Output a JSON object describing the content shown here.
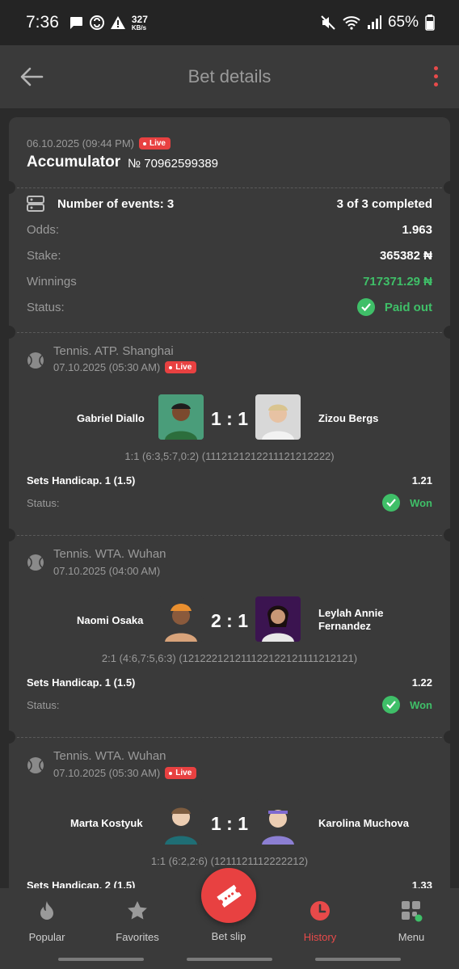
{
  "status_bar": {
    "time": "7:36",
    "speed_value": "327",
    "speed_unit": "KB/s",
    "battery": "65%"
  },
  "app_bar": {
    "title": "Bet details",
    "back_icon": "arrow-left-icon",
    "menu_icon": "kebab-menu-icon"
  },
  "bet": {
    "datetime": "06.10.2025 (09:44 PM)",
    "live_label": "Live",
    "type": "Accumulator",
    "number": "№ 70962599389",
    "events_label": "Number of events: 3",
    "completed": "3 of 3 completed",
    "odds_label": "Odds:",
    "odds_value": "1.963",
    "stake_label": "Stake:",
    "stake_value": "365382 ₦",
    "winnings_label": "Winnings",
    "winnings_value": "717371.29 ₦",
    "status_label": "Status:",
    "status_value": "Paid out"
  },
  "events": [
    {
      "league": "Tennis. ATP. Shanghai",
      "datetime": "07.10.2025 (05:30 AM)",
      "live": "Live",
      "player1": "Gabriel Diallo",
      "player2": "Zizou Bergs",
      "score": "1 : 1",
      "score_detail": "1:1 (6:3,5:7,0:2) (1112121212211121212222)",
      "market": "Sets Handicap. 1 (1.5)",
      "odds": "1.21",
      "status_label": "Status:",
      "status_value": "Won"
    },
    {
      "league": "Tennis. WTA. Wuhan",
      "datetime": "07.10.2025 (04:00 AM)",
      "player1": "Naomi Osaka",
      "player2": "Leylah Annie Fernandez",
      "score": "2 : 1",
      "score_detail": "2:1 (4:6,7:5,6:3) (121222121211122122121111212121)",
      "market": "Sets Handicap. 1 (1.5)",
      "odds": "1.22",
      "status_label": "Status:",
      "status_value": "Won"
    },
    {
      "league": "Tennis. WTA. Wuhan",
      "datetime": "07.10.2025 (05:30 AM)",
      "live": "Live",
      "player1": "Marta Kostyuk",
      "player2": "Karolina Muchova",
      "score": "1 : 1",
      "score_detail": "1:1 (6:2,2:6) (1211121112222212)",
      "market": "Sets Handicap. 2 (1.5)",
      "odds": "1.33"
    }
  ],
  "nav": {
    "popular": "Popular",
    "favorites": "Favorites",
    "bet_slip": "Bet slip",
    "history": "History",
    "menu": "Menu",
    "accent": "#e84a4a"
  }
}
